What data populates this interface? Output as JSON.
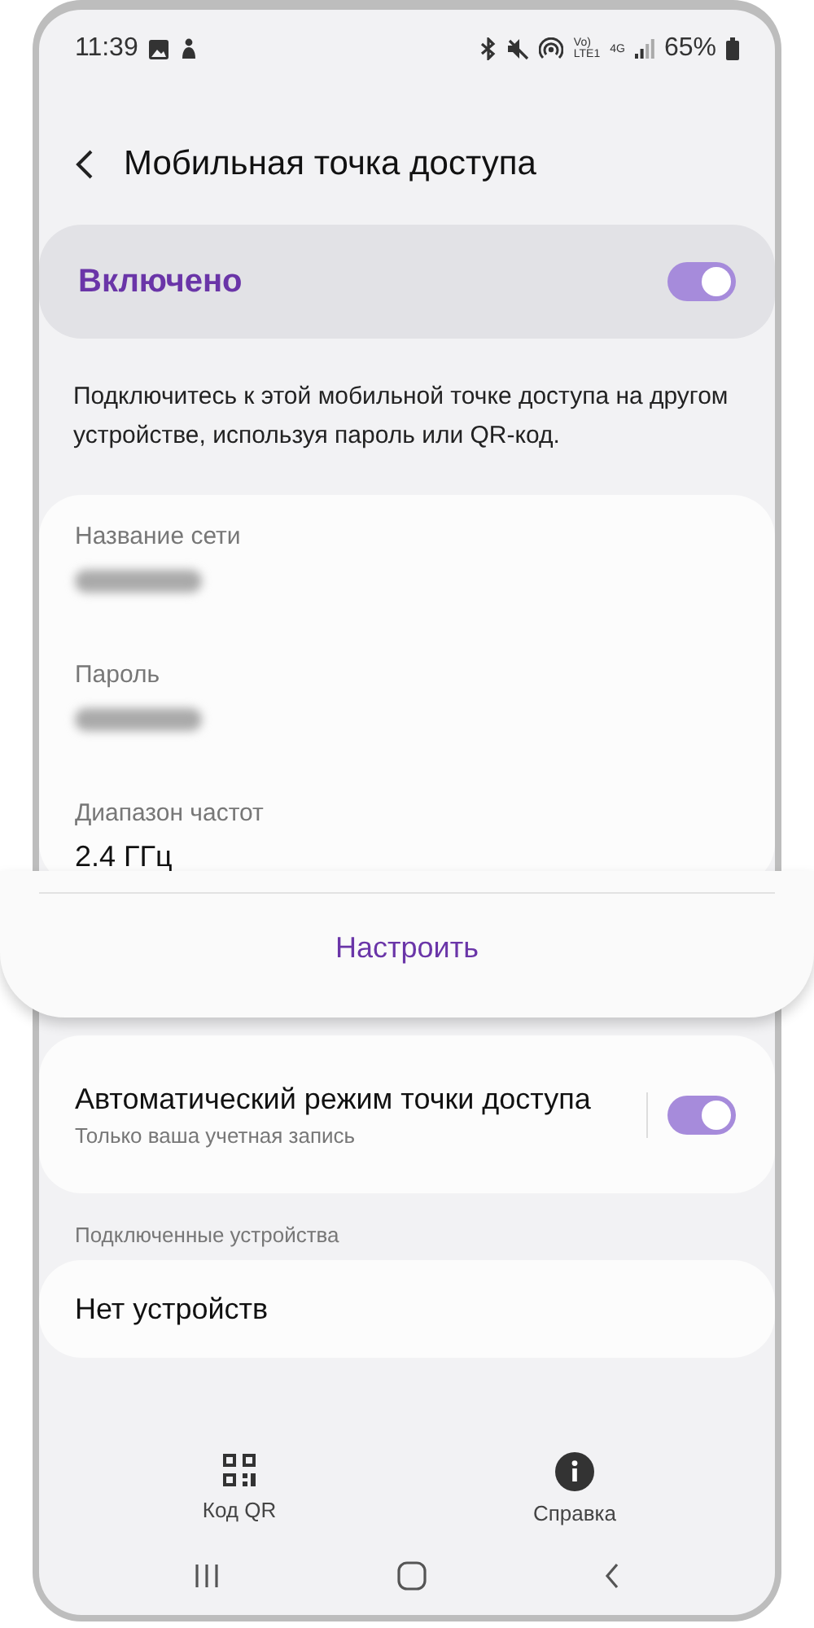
{
  "status_bar": {
    "time": "11:39",
    "volte_top": "Vo)",
    "volte_bottom": "LTE1",
    "network": "4G",
    "battery": "65%"
  },
  "header": {
    "title": "Мобильная точка доступа"
  },
  "master_switch": {
    "label": "Включено",
    "on": true
  },
  "description": "Подключитесь к этой мобильной точке доступа на другом устройстве, используя пароль или QR-код.",
  "network_fields": [
    {
      "label": "Название сети",
      "kind": "blurred"
    },
    {
      "label": "Пароль",
      "kind": "blurred"
    },
    {
      "label": "Диапазон частот",
      "kind": "text",
      "value": "2.4 ГГц"
    }
  ],
  "configure_button": "Настроить",
  "auto_hotspot": {
    "title": "Автоматический режим точки доступа",
    "subtitle": "Только ваша учетная запись",
    "on": true
  },
  "connected_devices": {
    "heading": "Подключенные устройства",
    "empty_text": "Нет устройств"
  },
  "bottom_actions": [
    {
      "kind": "qr",
      "label": "Код QR"
    },
    {
      "kind": "help",
      "label": "Справка"
    }
  ]
}
